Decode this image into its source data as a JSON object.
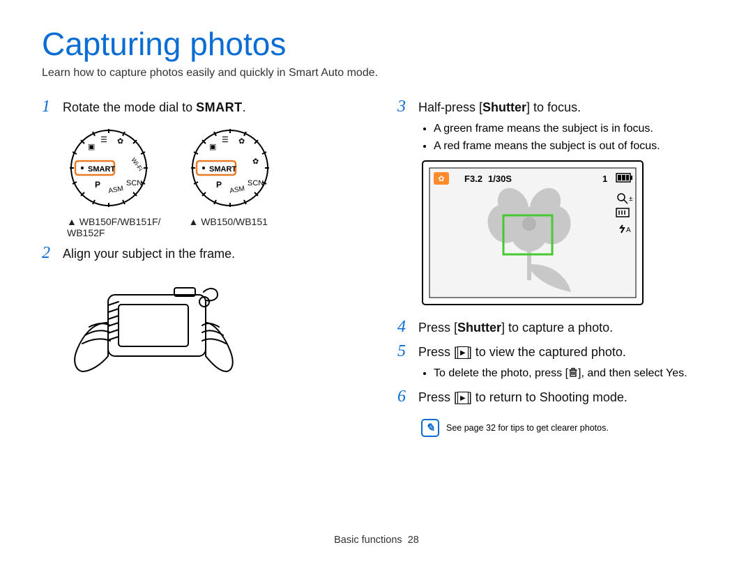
{
  "title": "Capturing photos",
  "subtitle": "Learn how to capture photos easily and quickly in Smart Auto mode.",
  "left": {
    "step1_num": "1",
    "step1_text_before": "Rotate the mode dial to ",
    "step1_smart": "SMART",
    "step1_after": ".",
    "dial_labels": [
      "SMART",
      "SMART"
    ],
    "dial_captions": [
      "▲ WB150F/WB151F/\nWB152F",
      "▲ WB150/WB151"
    ],
    "step2_num": "2",
    "step2_text": "Align your subject in the frame."
  },
  "right": {
    "step3_num": "3",
    "step3_a": "Half-press [",
    "step3_b": "Shutter",
    "step3_c": "] to focus.",
    "bullet3_1": "A green frame means the subject is in focus.",
    "bullet3_2": "A red frame means the subject is out of focus.",
    "lcd": {
      "f": "F3.2",
      "shutter": "1/30S",
      "count": "1"
    },
    "step4_num": "4",
    "step4_a": "Press [",
    "step4_b": "Shutter",
    "step4_c": "] to capture a photo.",
    "step5_num": "5",
    "step5_a": "Press [",
    "step5_b": "",
    "step5_c": "] to view the captured photo.",
    "bullet5_a": "To delete the photo, press [",
    "bullet5_b": "], and then select ",
    "bullet5_yes": "Yes",
    "bullet5_c": ".",
    "step6_num": "6",
    "step6_a": "Press [",
    "step6_b": "",
    "step6_c": "] to return to Shooting mode."
  },
  "tip": "See page 32 for tips to get clearer photos.",
  "footer_label": "Basic functions",
  "footer_page": "28"
}
